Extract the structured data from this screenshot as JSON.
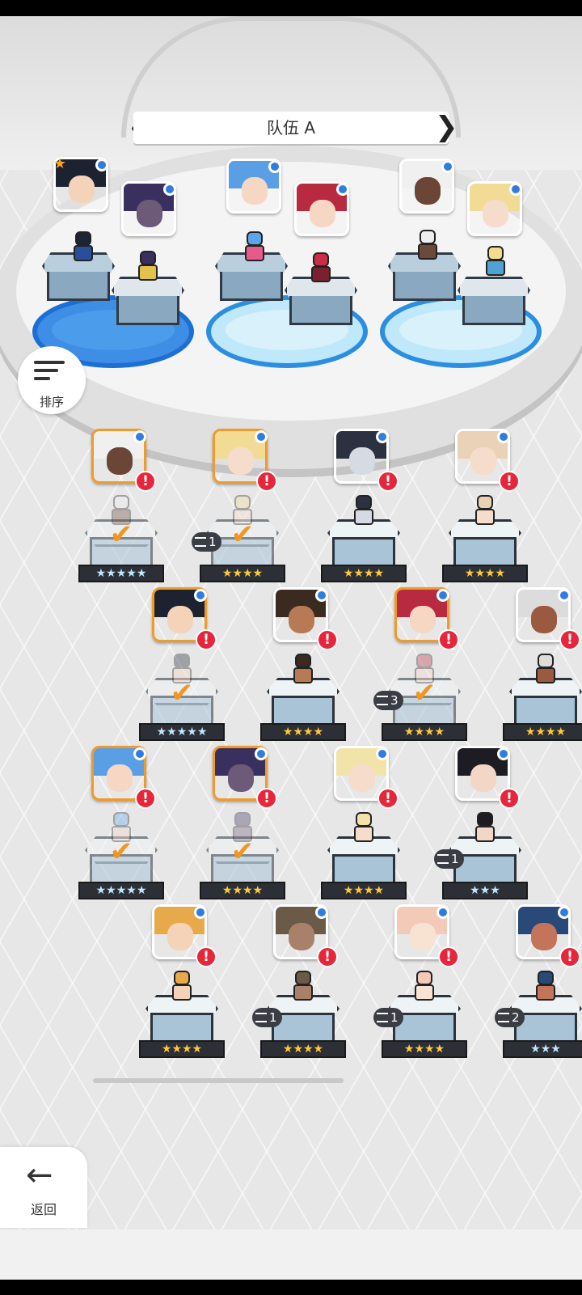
{
  "team": {
    "title": "队伍 A"
  },
  "sort_button": {
    "label": "排序"
  },
  "back_button": {
    "label": "返回"
  },
  "colors": {
    "selected_border": "#f09a2a",
    "alert": "#e8263b",
    "equip_dot": "#2f7de0",
    "pool_blue": "#3f8ee6"
  },
  "alert_glyph": "!",
  "check_glyph": "✔",
  "roster": [
    {
      "row": 1,
      "col": 1,
      "stars": "★★★★★",
      "star_color": "blue",
      "in_team": true,
      "dup": ""
    },
    {
      "row": 1,
      "col": 2,
      "stars": "★★★★",
      "star_color": "gold",
      "in_team": true,
      "dup": "1"
    },
    {
      "row": 1,
      "col": 3,
      "stars": "★★★★",
      "star_color": "gold",
      "in_team": false,
      "dup": ""
    },
    {
      "row": 1,
      "col": 4,
      "stars": "★★★★",
      "star_color": "gold",
      "in_team": false,
      "dup": ""
    },
    {
      "row": 2,
      "col": 1,
      "stars": "★★★★★",
      "star_color": "blue",
      "in_team": true,
      "dup": ""
    },
    {
      "row": 2,
      "col": 2,
      "stars": "★★★★",
      "star_color": "gold",
      "in_team": false,
      "dup": ""
    },
    {
      "row": 2,
      "col": 3,
      "stars": "★★★★",
      "star_color": "gold",
      "in_team": true,
      "dup": "3"
    },
    {
      "row": 2,
      "col": 4,
      "stars": "★★★★",
      "star_color": "gold",
      "in_team": false,
      "dup": ""
    },
    {
      "row": 3,
      "col": 1,
      "stars": "★★★★★",
      "star_color": "blue",
      "in_team": true,
      "dup": ""
    },
    {
      "row": 3,
      "col": 2,
      "stars": "★★★★",
      "star_color": "gold",
      "in_team": true,
      "dup": ""
    },
    {
      "row": 3,
      "col": 3,
      "stars": "★★★★",
      "star_color": "gold",
      "in_team": false,
      "dup": ""
    },
    {
      "row": 3,
      "col": 4,
      "stars": "★★★",
      "star_color": "blue",
      "in_team": false,
      "dup": "1"
    },
    {
      "row": 4,
      "col": 1,
      "stars": "★★★★",
      "star_color": "gold",
      "in_team": false,
      "dup": ""
    },
    {
      "row": 4,
      "col": 2,
      "stars": "★★★★",
      "star_color": "gold",
      "in_team": false,
      "dup": "1"
    },
    {
      "row": 4,
      "col": 3,
      "stars": "★★★★",
      "star_color": "gold",
      "in_team": false,
      "dup": "1"
    },
    {
      "row": 4,
      "col": 4,
      "stars": "★★★",
      "star_color": "blue",
      "in_team": false,
      "dup": "2"
    }
  ]
}
